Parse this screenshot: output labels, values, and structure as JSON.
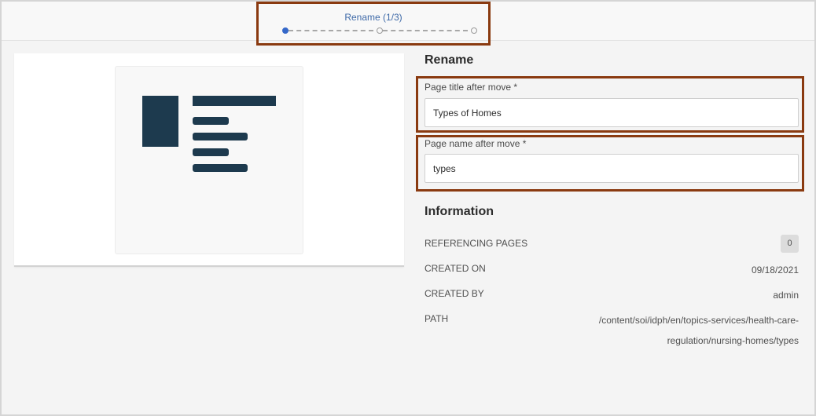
{
  "wizard": {
    "step_title": "Rename (1/3)",
    "current_step": 1,
    "total_steps": 3
  },
  "preview": {
    "thumbnail_icon": "page-template-icon",
    "thumbnail_color": "#1d3a4e"
  },
  "rename": {
    "heading": "Rename",
    "title_label": "Page title after move *",
    "title_value": "Types of Homes",
    "name_label": "Page name after move *",
    "name_value": "types"
  },
  "information": {
    "heading": "Information",
    "referencing_pages_label": "REFERENCING PAGES",
    "referencing_pages_value": "0",
    "created_on_label": "CREATED ON",
    "created_on_value": "09/18/2021",
    "created_by_label": "CREATED BY",
    "created_by_value": "admin",
    "path_label": "PATH",
    "path_value": "/content/soi/idph/en/topics-services/health-care-regulation/nursing-homes/types"
  },
  "colors": {
    "accent": "#3568c9",
    "highlight_box": "#8a3a10"
  }
}
